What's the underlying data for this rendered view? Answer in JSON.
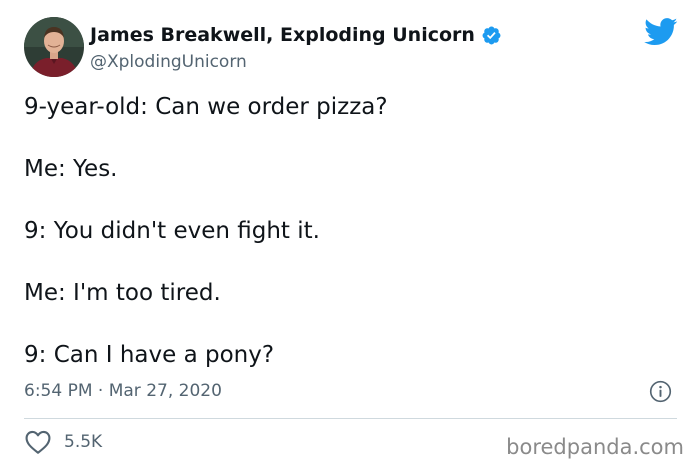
{
  "author": {
    "display_name": "James Breakwell, Exploding Unicorn",
    "handle": "@XplodingUnicorn",
    "verified": true,
    "avatar_icon": "avatar-photo"
  },
  "tweet": {
    "lines": [
      "9-year-old: Can we order pizza?",
      "Me: Yes.",
      "9: You didn't even fight it.",
      "Me: I'm too tired.",
      "9: Can I have a pony?"
    ],
    "timestamp": "6:54 PM · Mar 27, 2020"
  },
  "actions": {
    "like_count": "5.5K",
    "like_icon": "heart-icon",
    "info_icon": "info-icon"
  },
  "branding": {
    "platform_icon": "twitter-bird-icon",
    "watermark": "boredpanda.com"
  },
  "colors": {
    "twitter_blue": "#1d9bf0",
    "text_primary": "#0f1419",
    "text_secondary": "#536471",
    "divider": "#cfd9de",
    "watermark": "#8a8a8a"
  }
}
